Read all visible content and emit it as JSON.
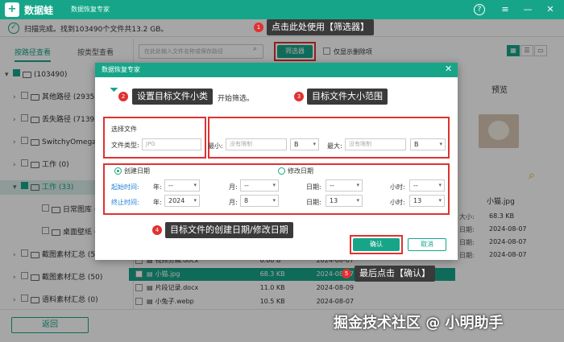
{
  "app": {
    "brand": "数据蛙",
    "subtitle": "数据恢复专家"
  },
  "window_controls": {
    "help": "?",
    "menu": "≡",
    "minimize": "—",
    "close": "✕"
  },
  "status": {
    "text": "扫描完成。找到103490个文件共13.2 GB。"
  },
  "left_tabs": {
    "by_path": "按路径查看",
    "by_type": "按类型查看"
  },
  "search": {
    "placeholder": "在此处输入文件名称或保存路径"
  },
  "toolbar": {
    "filter_label": "筛选器",
    "only_deleted": "仅显示删除项"
  },
  "tree": [
    {
      "arrow": "▾",
      "label": "(103490)",
      "checked": "partial"
    },
    {
      "arrow": "›",
      "label": "其他路径 (2935"
    },
    {
      "arrow": "›",
      "label": "丢失路径 (7139"
    },
    {
      "arrow": "›",
      "label": "SwitchyOmega"
    },
    {
      "arrow": "›",
      "label": "工作 (0)"
    },
    {
      "arrow": "▾",
      "label": "工作 (33)",
      "selected": true
    },
    {
      "arrow": "",
      "label": "日常图库 (2"
    },
    {
      "arrow": "",
      "label": "桌面壁纸 (1"
    },
    {
      "arrow": "›",
      "label": "截图素材汇总 (50)"
    },
    {
      "arrow": "›",
      "label": "截图素材汇总 (50)"
    },
    {
      "arrow": "›",
      "label": "语料素材汇总 (0)"
    }
  ],
  "files": [
    {
      "name": "视频剪辑.docx",
      "size": "0.00 B",
      "date": "2024-08-07"
    },
    {
      "name": "小猫.jpg",
      "size": "68.3 KB",
      "date": "2024-08-07"
    },
    {
      "name": "片段记录.docx",
      "size": "11.0 KB",
      "date": "2024-08-09"
    },
    {
      "name": "小兔子.webp",
      "size": "10.5 KB",
      "date": "2024-08-07"
    }
  ],
  "preview": {
    "title": "预览",
    "filename": "小猫.jpg",
    "props": [
      {
        "label": "大小:",
        "value": "68.3 KB"
      },
      {
        "label": "日期:",
        "value": "2024-08-07"
      },
      {
        "label": "日期:",
        "value": "2024-08-07"
      },
      {
        "label": "日期:",
        "value": "2024-08-07"
      }
    ]
  },
  "back_button": "返回",
  "watermark": "掘金技术社区 @ 小明助手",
  "dialog": {
    "title": "数据恢复专家",
    "close": "✕",
    "hint": "开始筛选。",
    "select_file": "选择文件",
    "file_type_label": "文件类型:",
    "file_type_placeholder": "JPG",
    "min_label": "最小:",
    "min_placeholder": "没有限制",
    "min_unit": "B",
    "max_label": "最大:",
    "max_placeholder": "没有限制",
    "max_unit": "B",
    "created_date": "创建日期",
    "modified_date": "修改日期",
    "start_time": "起始时间:",
    "end_time": "终止时间:",
    "year": "年:",
    "month": "月:",
    "day": "日期:",
    "hour": "小时:",
    "start": {
      "year": "--",
      "month": "--",
      "day": "--",
      "hour": "--"
    },
    "end": {
      "year": "2024",
      "month": "8",
      "day": "13",
      "hour": "13"
    },
    "ok": "确认",
    "cancel": "取消"
  },
  "callouts": [
    {
      "num": "1",
      "text": "点击此处使用【筛选器】"
    },
    {
      "num": "2",
      "text": "设置目标文件小类"
    },
    {
      "num": "3",
      "text": "目标文件大小范围"
    },
    {
      "num": "4",
      "text": "目标文件的创建日期/修改日期"
    },
    {
      "num": "5",
      "text": "最后点击【确认】"
    }
  ],
  "colors": {
    "accent": "#17a589",
    "highlight": "#e03131"
  }
}
